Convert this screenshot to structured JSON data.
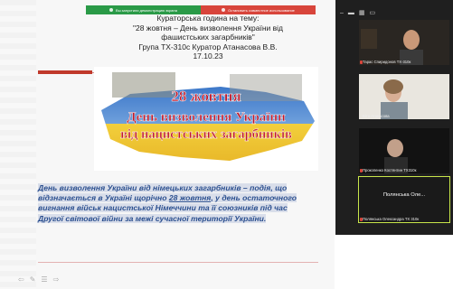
{
  "screen_share": {
    "stop_label": "Вы запустили демонстрацию экрана",
    "stop_sharing_label": "Остановить совместное использование"
  },
  "slide": {
    "title_lines": [
      "Кураторська година на тему:",
      "\"28 жовтня – День визволення  України від",
      "фашистських загарбників\"",
      "Група ТХ-310с Куратор Атанасова В.В.",
      "17.10.23"
    ],
    "banner": {
      "line1": "28 жовтня",
      "line2": "День визволення України",
      "line3": "від нацистських загарбників"
    },
    "body": {
      "p1": "День визволення України від німецьких загарбників – подія, що",
      "p2a": "відзначається в Україні  щорічно ",
      "p2u": "28 жовтня",
      "p2b": ", у день остаточного",
      "p3": "вигнання військ нацистської Німеччини та її союзників під час",
      "p4": "Другої світової війни  за межі сучасної території України."
    }
  },
  "video_panel": {
    "participants": [
      {
        "name": "Тарас Спиридонов ТХ-310к"
      },
      {
        "name": "Віта Атанасова"
      },
      {
        "name": "Прокопенко Костянтин ТХ310к"
      },
      {
        "name": "Полянська Олександра ТХ 310к",
        "center_label": "Полянська Оле..."
      }
    ]
  }
}
